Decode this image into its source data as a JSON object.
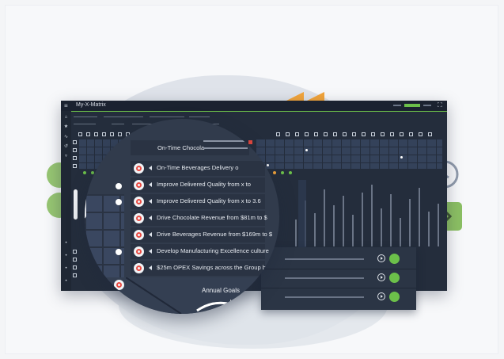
{
  "app": {
    "title": "My-X-Matrix",
    "colors": {
      "accent_green": "#6cc04a",
      "accent_orange": "#f2a43a",
      "accent_red": "#e94b43",
      "app_bg": "#242d3c"
    }
  },
  "goals": [
    "On-Time Chocola",
    "On-Time Beverages Delivery o",
    "Improve Delivered Quality from x to",
    "Improve Delivered Quality from x to 3.6",
    "Drive Chocolate Revenue from $81m to $",
    "Drive Beverages Revenue from $169m to $",
    "Develop Manufacturing Excellence culture",
    "$25m OPEX Savings across the Group by e"
  ],
  "annual_goals_label": "Annual Goals",
  "rotated_label": "Ac",
  "icons": {
    "rewind": "rewind-icon",
    "next": "chevron-right-icon",
    "refresh": "refresh-icon",
    "play": "play-icon"
  }
}
